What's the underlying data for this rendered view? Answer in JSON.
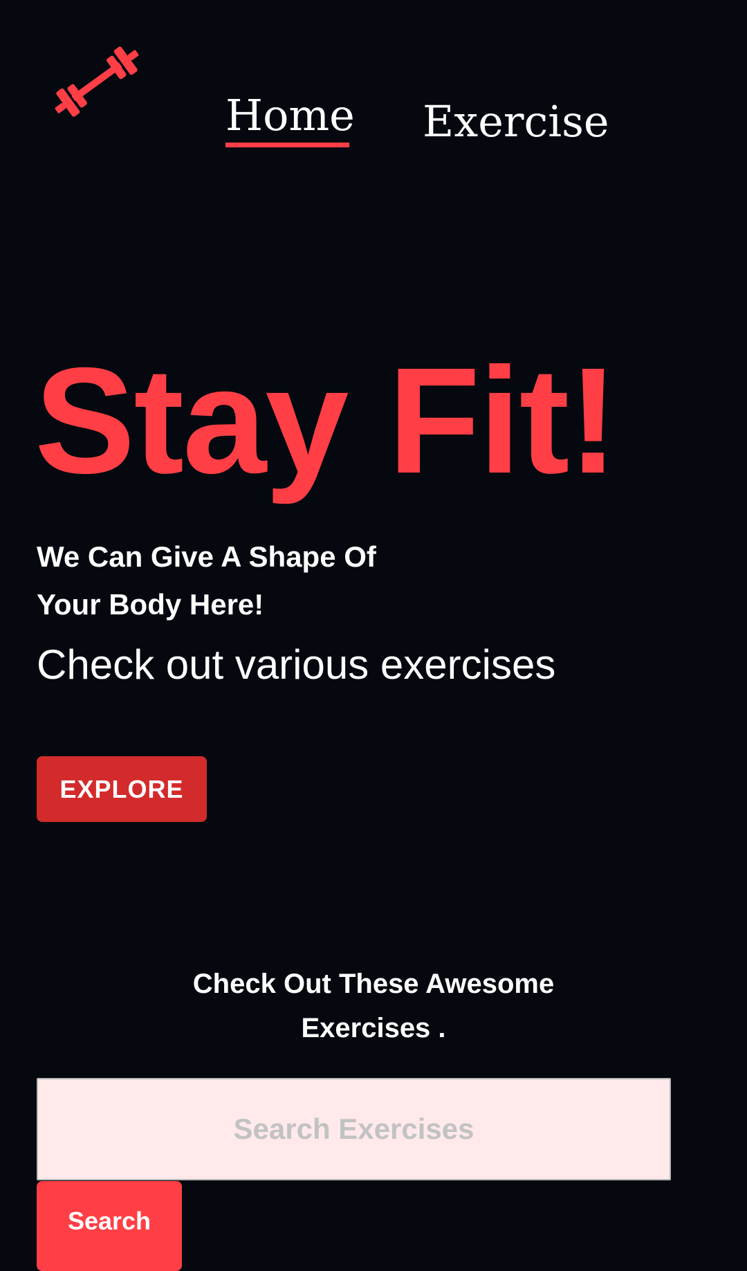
{
  "nav": {
    "logo_icon": "dumbbell-icon",
    "home_label": "Home",
    "exercise_label": "Exercise",
    "active": "Home"
  },
  "hero": {
    "title": "Stay Fit!",
    "tagline_line1": "We Can Give A Shape Of",
    "tagline_line2": "Your Body Here!",
    "subtitle": "Check out various exercises",
    "explore_label": "EXPLORE"
  },
  "search": {
    "heading_line1": "Check Out These Awesome",
    "heading_line2": "Exercises .",
    "placeholder": "Search Exercises",
    "value": "",
    "button_label": "Search"
  },
  "colors": {
    "background": "#05080f",
    "accent": "#ff3f45",
    "explore_button": "#d32b2b",
    "search_field": "#ffe9eb"
  }
}
